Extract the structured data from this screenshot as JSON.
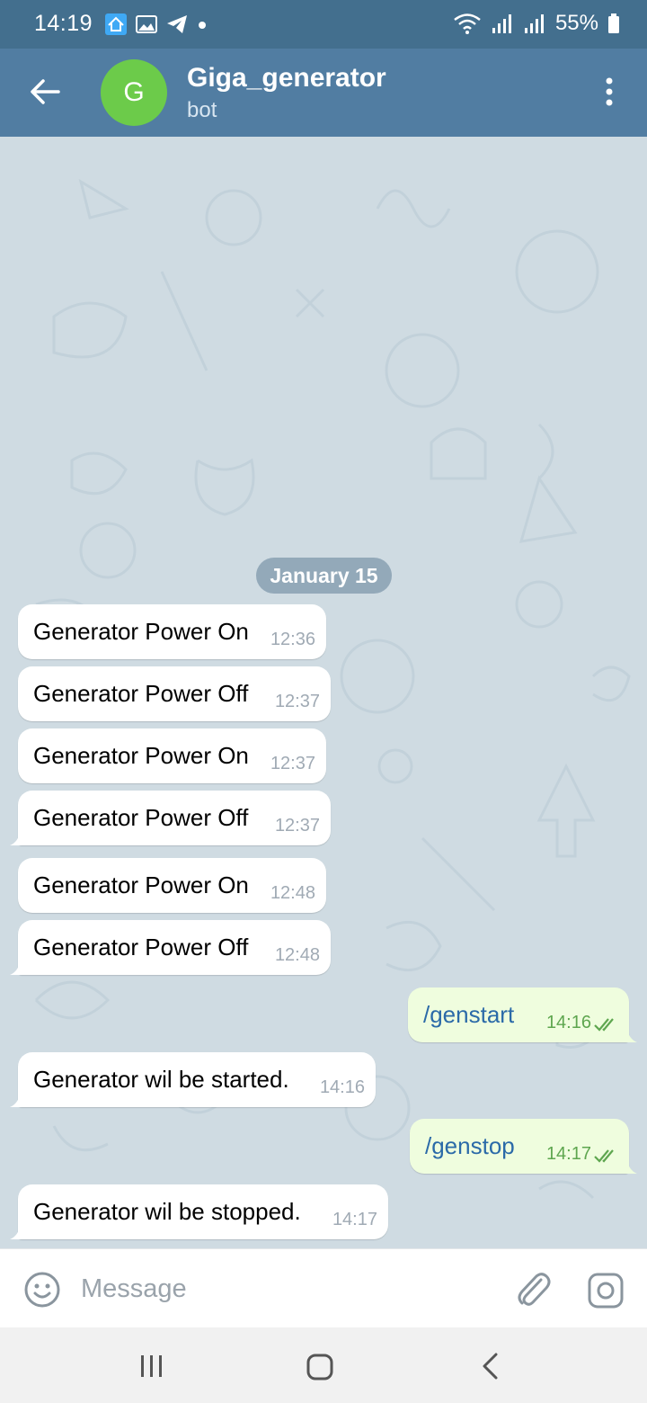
{
  "status_bar": {
    "time": "14:19",
    "battery": "55%",
    "icons": [
      "smart-home-icon",
      "gallery-icon",
      "telegram-icon",
      "dot-icon",
      "wifi-icon",
      "signal-icon",
      "signal-icon",
      "battery-icon"
    ]
  },
  "header": {
    "avatar_letter": "G",
    "title": "Giga_generator",
    "subtitle": "bot",
    "avatar_color": "#6ccb4a",
    "bar_color": "#517da2"
  },
  "chat": {
    "date": "January 15",
    "messages": [
      {
        "direction": "in",
        "text": "Generator Power On",
        "time": "12:36"
      },
      {
        "direction": "in",
        "text": "Generator Power Off",
        "time": "12:37"
      },
      {
        "direction": "in",
        "text": "Generator Power On",
        "time": "12:37"
      },
      {
        "direction": "in",
        "text": "Generator Power Off",
        "time": "12:37"
      },
      {
        "direction": "in",
        "text": "Generator Power On",
        "time": "12:48"
      },
      {
        "direction": "in",
        "text": "Generator Power Off",
        "time": "12:48"
      },
      {
        "direction": "out",
        "text": "/genstart",
        "time": "14:16",
        "read": true
      },
      {
        "direction": "in",
        "text": "Generator wil be started.",
        "time": "14:16"
      },
      {
        "direction": "out",
        "text": "/genstop",
        "time": "14:17",
        "read": true
      },
      {
        "direction": "in",
        "text": "Generator wil be stopped.",
        "time": "14:17"
      }
    ]
  },
  "composer": {
    "placeholder": "Message"
  }
}
